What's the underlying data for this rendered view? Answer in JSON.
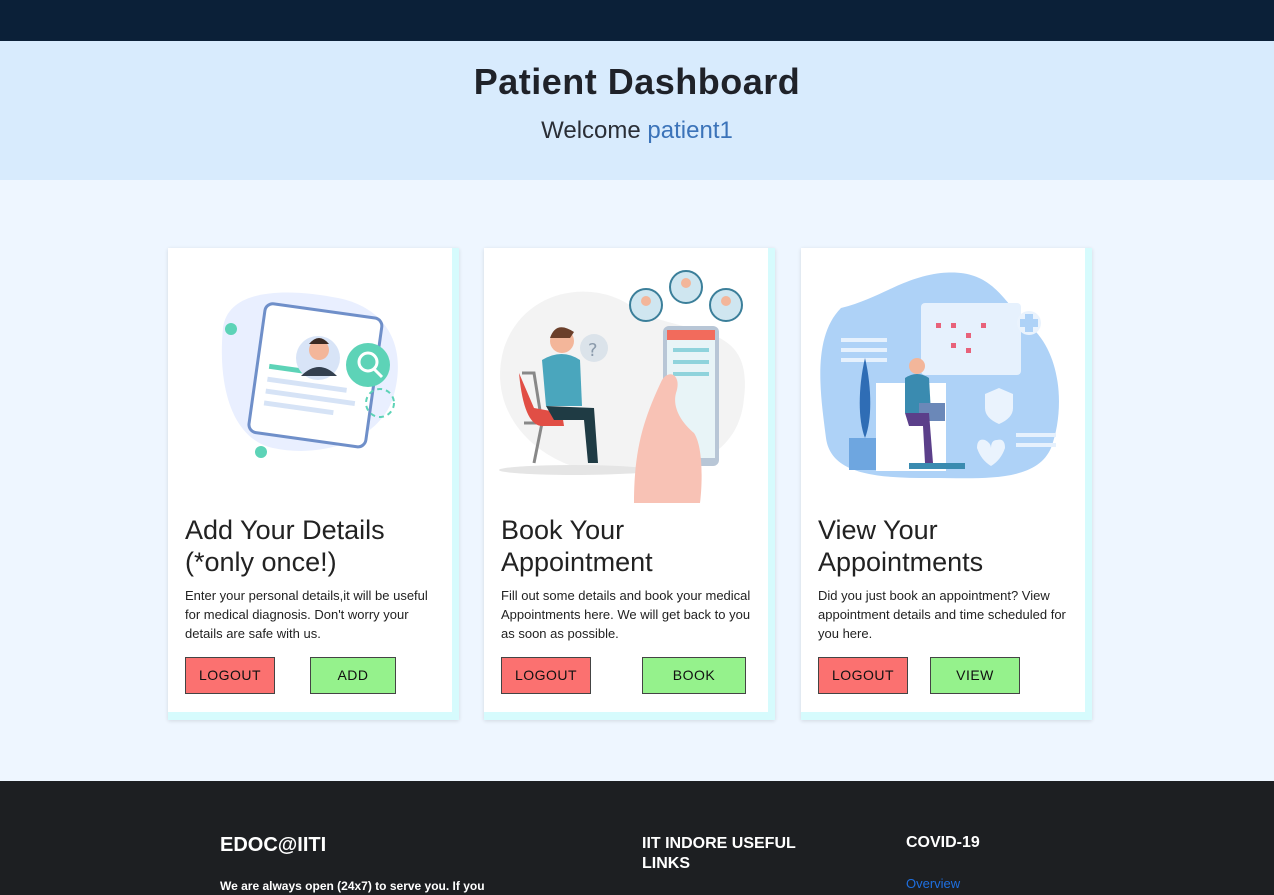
{
  "header": {
    "title": "Patient Dashboard",
    "welcome_prefix": "Welcome",
    "username": "patient1"
  },
  "cards": [
    {
      "title": "Add Your Details (*only once!)",
      "description": "Enter your personal details,it will be useful for medical diagnosis. Don't worry your details are safe with us.",
      "logout_label": "LOGOUT",
      "action_label": "ADD"
    },
    {
      "title": "Book Your Appointment",
      "description": "Fill out some details and book your medical Appointments here. We will get back to you as soon as possible.",
      "logout_label": "LOGOUT",
      "action_label": "BOOK"
    },
    {
      "title": "View Your Appointments",
      "description": "Did you just book an appointment? View appointment details and time scheduled for you here.",
      "logout_label": "LOGOUT",
      "action_label": "VIEW"
    }
  ],
  "footer": {
    "brand": "EDOC@IITI",
    "about_text": "We are always open (24x7) to serve you. If you",
    "links_heading": "IIT INDORE USEFUL LINKS",
    "covid_heading": "COVID-19",
    "covid_link": "Overview"
  },
  "colors": {
    "topbar": "#0b2038",
    "header_bg": "#d8ebfd",
    "logout_button": "#fb7170",
    "action_button": "#95f28c",
    "footer_bg": "#1d1f22",
    "username": "#3b73b9"
  }
}
